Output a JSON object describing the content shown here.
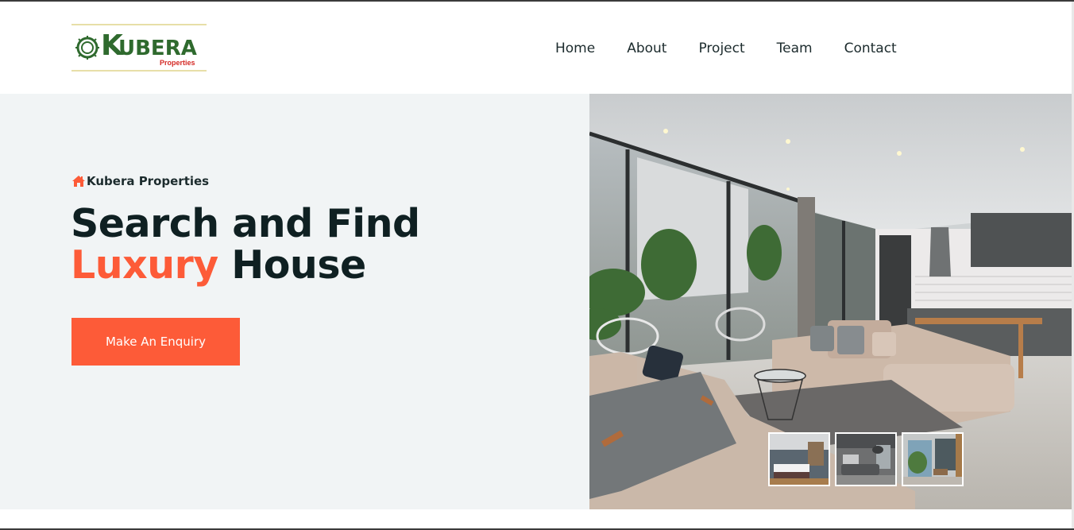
{
  "brand": {
    "logo_initial": "K",
    "logo_word": "UBERA",
    "logo_sub": "Properties",
    "colors": {
      "green": "#2f6a2e",
      "red": "#d42a25",
      "accent": "#fd5b38",
      "dark": "#0f2022"
    }
  },
  "nav": {
    "items": [
      {
        "label": "Home"
      },
      {
        "label": "About"
      },
      {
        "label": "Project"
      },
      {
        "label": "Team"
      },
      {
        "label": "Contact"
      }
    ]
  },
  "hero": {
    "kicker_icon": "home-icon",
    "kicker": "Kubera Properties",
    "headline_line1": "Search and Find",
    "headline_accent": "Luxury",
    "headline_rest": " House",
    "cta_label": "Make An Enquiry"
  },
  "gallery": {
    "thumbnails": [
      {
        "icon": "bedroom-thumbnail"
      },
      {
        "icon": "living-room-thumbnail"
      },
      {
        "icon": "balcony-thumbnail"
      }
    ]
  }
}
